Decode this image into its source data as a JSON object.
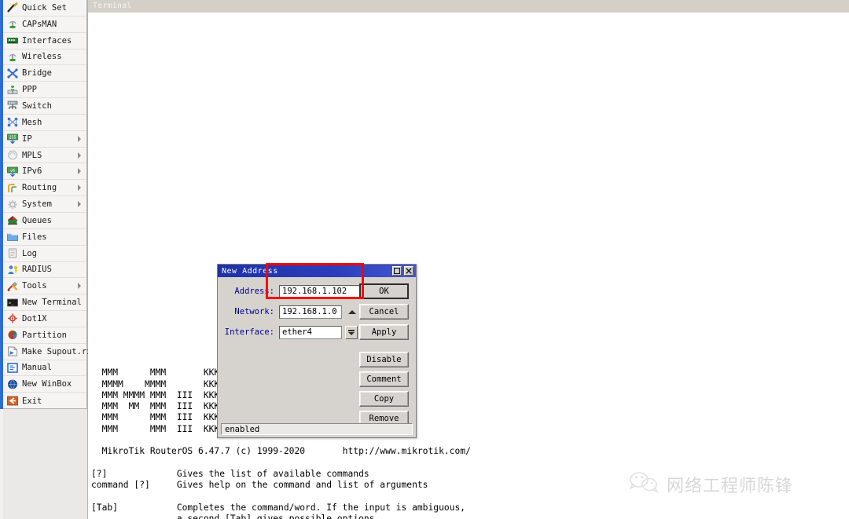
{
  "sidebar": {
    "items": [
      {
        "label": "Quick Set",
        "icon": "wand-icon",
        "submenu": false
      },
      {
        "label": "CAPsMAN",
        "icon": "antenna-icon",
        "submenu": false
      },
      {
        "label": "Interfaces",
        "icon": "network-card-icon",
        "submenu": false
      },
      {
        "label": "Wireless",
        "icon": "antenna-icon",
        "submenu": false
      },
      {
        "label": "Bridge",
        "icon": "bridge-icon",
        "submenu": false
      },
      {
        "label": "PPP",
        "icon": "ppp-icon",
        "submenu": false
      },
      {
        "label": "Switch",
        "icon": "switch-icon",
        "submenu": false
      },
      {
        "label": "Mesh",
        "icon": "mesh-icon",
        "submenu": false
      },
      {
        "label": "IP",
        "icon": "ip-icon",
        "submenu": true
      },
      {
        "label": "MPLS",
        "icon": "mpls-icon",
        "submenu": true
      },
      {
        "label": "IPv6",
        "icon": "ipv6-icon",
        "submenu": true
      },
      {
        "label": "Routing",
        "icon": "routing-icon",
        "submenu": true
      },
      {
        "label": "System",
        "icon": "gear-icon",
        "submenu": true
      },
      {
        "label": "Queues",
        "icon": "queues-icon",
        "submenu": false
      },
      {
        "label": "Files",
        "icon": "folder-icon",
        "submenu": false
      },
      {
        "label": "Log",
        "icon": "log-icon",
        "submenu": false
      },
      {
        "label": "RADIUS",
        "icon": "radius-icon",
        "submenu": false
      },
      {
        "label": "Tools",
        "icon": "tools-icon",
        "submenu": true
      },
      {
        "label": "New Terminal",
        "icon": "terminal-icon",
        "submenu": false
      },
      {
        "label": "Dot1X",
        "icon": "dot1x-icon",
        "submenu": false
      },
      {
        "label": "Partition",
        "icon": "partition-icon",
        "submenu": false
      },
      {
        "label": "Make Supout.rif",
        "icon": "supout-icon",
        "submenu": false
      },
      {
        "label": "Manual",
        "icon": "manual-icon",
        "submenu": false
      },
      {
        "label": "New WinBox",
        "icon": "winbox-icon",
        "submenu": false
      },
      {
        "label": "Exit",
        "icon": "exit-icon",
        "submenu": false
      }
    ]
  },
  "terminal": {
    "title": "Terminal",
    "content": "  MMM      MMM       KKK                          KKK\n  MMMM    MMMM       KKK                          KKK\n  MMM MMMM MMM  III  KKK  KKK  RRRRRR    OOOOOO   KKK  KKK\n  MMM  MM  MMM  III  KKKKK     RRR  RRR OOO  OOO  KKKKK\n  MMM      MMM  III  KKK KKK   RRRRRR   OOO  OOO  KKK KKK\n  MMM      MMM  III  KKK  KKK  RRR  RRR  OOOOOO   KKK  KKK\n\n  MikroTik RouterOS 6.47.7 (c) 1999-2020       http://www.mikrotik.com/\n\n[?]             Gives the list of available commands\ncommand [?]     Gives help on the command and list of arguments\n\n[Tab]           Completes the command/word. If the input is ambiguous,\n                a second [Tab] gives possible options"
  },
  "dialog": {
    "title": "New Address",
    "maximize_icon": "maximize-icon",
    "close_icon": "close-icon",
    "fields": {
      "address": {
        "label": "Address:",
        "value": "192.168.1.102"
      },
      "network": {
        "label": "Network:",
        "value": "192.168.1.0"
      },
      "interface": {
        "label": "Interface:",
        "value": "ether4"
      }
    },
    "buttons": [
      {
        "label": "OK",
        "default": true
      },
      {
        "label": "Cancel",
        "default": false
      },
      {
        "label": "Apply",
        "default": false
      },
      {
        "label": "Disable",
        "default": false
      },
      {
        "label": "Comment",
        "default": false
      },
      {
        "label": "Copy",
        "default": false
      },
      {
        "label": "Remove",
        "default": false
      }
    ],
    "status": "enabled"
  },
  "annotation": {
    "highlight_color": "#ff0000"
  },
  "watermark": {
    "icon": "wechat-icon",
    "text": "网络工程师陈锋"
  }
}
